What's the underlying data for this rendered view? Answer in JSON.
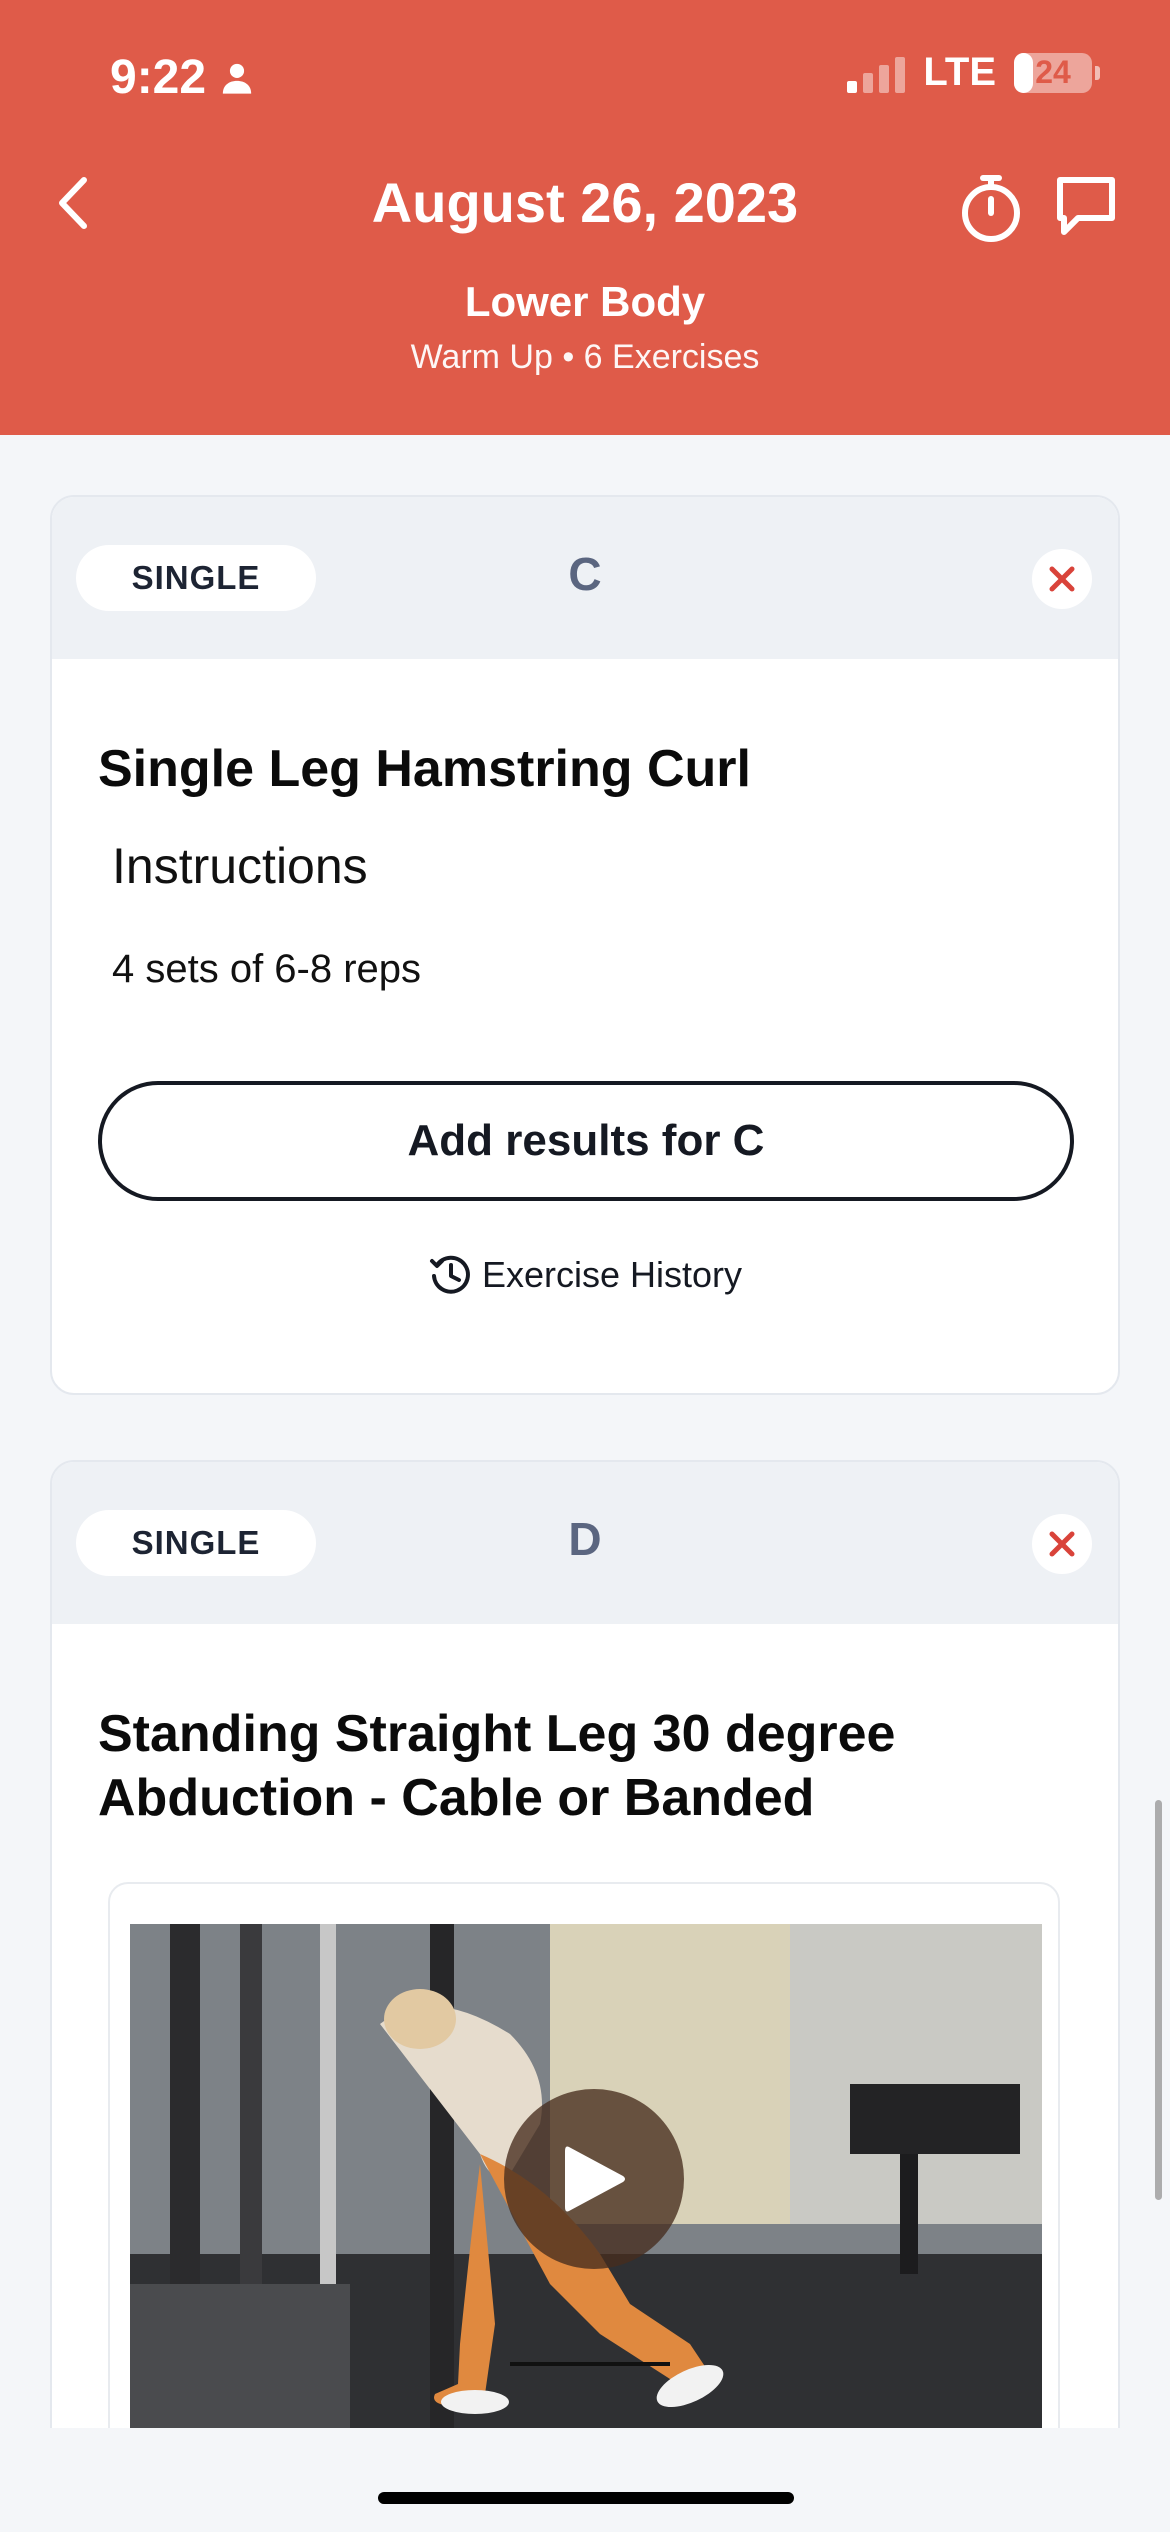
{
  "status_bar": {
    "time": "9:22",
    "network": "LTE",
    "battery": "24",
    "battery_level": 0.24
  },
  "header": {
    "date": "August 26, 2023",
    "workout_name": "Lower Body",
    "workout_meta": "Warm Up • 6 Exercises"
  },
  "cards": [
    {
      "type": "SINGLE",
      "letter": "C",
      "title": "Single Leg Hamstring Curl",
      "instructions_label": "Instructions",
      "instructions": "4 sets of 6-8 reps",
      "add_results": "Add results for C",
      "history": "Exercise History"
    },
    {
      "type": "SINGLE",
      "letter": "D",
      "title_line1": "Standing Straight Leg 30 degree",
      "title_line2": "Abduction - Cable or Banded"
    }
  ],
  "colors": {
    "brand": "#df5b49",
    "close": "#d9433a"
  }
}
